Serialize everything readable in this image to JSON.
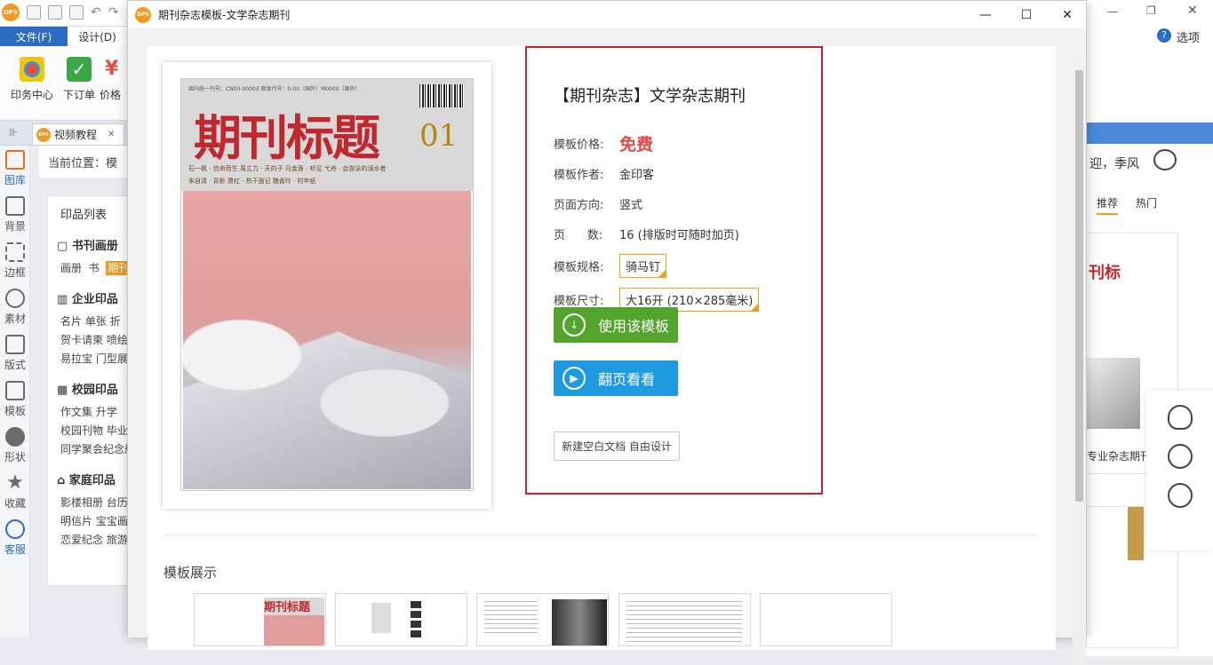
{
  "background_app": {
    "menu": {
      "file": "文件(F)",
      "design": "设计(D)"
    },
    "ribbon": [
      {
        "label": "印务中心",
        "icon": "print-center-icon"
      },
      {
        "label": "下订单",
        "icon": "order-check-icon"
      },
      {
        "label": "价格",
        "icon": "price-icon"
      }
    ],
    "tab": {
      "label": "视频教程",
      "close": "✕"
    },
    "sidenav": [
      "图库",
      "背景",
      "边框",
      "素材",
      "版式",
      "模板",
      "形状",
      "收藏",
      "客服"
    ],
    "breadcrumb": "当前位置：模",
    "library": {
      "title": "印品列表",
      "groups": [
        {
          "name": "书刊画册",
          "rows": [
            "画册  书  期刊"
          ]
        },
        {
          "name": "企业印品",
          "rows": [
            "名片  单张  折",
            "贺卡请柬  喷绘",
            "易拉宝  门型展"
          ]
        },
        {
          "name": "校园印品",
          "rows": [
            "作文集  升学",
            "校园刊物  毕业",
            "同学聚会纪念册"
          ]
        },
        {
          "name": "家庭印品",
          "rows": [
            "影楼相册  台历",
            "明信片  宝宝画",
            "恋爱纪念  旅游"
          ]
        }
      ],
      "highlight": "期刊"
    },
    "right": {
      "welcome": "迎，季风",
      "options": "选项",
      "tabs": [
        "推荐",
        "热门"
      ],
      "card_caption": "专业杂志期刊"
    }
  },
  "dialog": {
    "title": "期刊杂志模板-文学杂志期刊",
    "window_buttons": {
      "minimize": "—",
      "maximize": "☐",
      "close": "✕"
    },
    "cover": {
      "masthead": "期刊标题",
      "issue": "01",
      "top_line": "国内统一刊号：CN00-0000/I    邮发代号：0-00（国外）M0000（国外）",
      "lines": [
        "石一枫 · 信命而生    周立力 · 天的子    马金莲 · 听见    弋舟 · 会游泳的溺水者",
        "朱自清 · 背影    萧红 · 热干面记    魏香玲 · 时年纸"
      ]
    },
    "product": {
      "name": "【期刊杂志】文学杂志期刊",
      "price_label": "模板价格:",
      "price": "免费",
      "author_label": "模板作者:",
      "author": "金印客",
      "orientation_label": "页面方向:",
      "orientation": "竖式",
      "pages_label": "页      数:",
      "pages": "16 (排版时可随时加页)",
      "spec_label": "模板规格:",
      "spec": "骑马钉",
      "size_label": "模板尺寸:",
      "size": "大16开 (210×285毫米)"
    },
    "buttons": {
      "use": "使用该模板",
      "flip": "翻页看看",
      "new_blank": "新建空白文档 自由设计"
    },
    "showcase_title": "模板展示",
    "colors": {
      "use_button": "#52a52a",
      "flip_button": "#1e9be0",
      "highlight_box": "#c8232c",
      "price": "#e64646",
      "selected_border": "#f0a21e"
    }
  }
}
